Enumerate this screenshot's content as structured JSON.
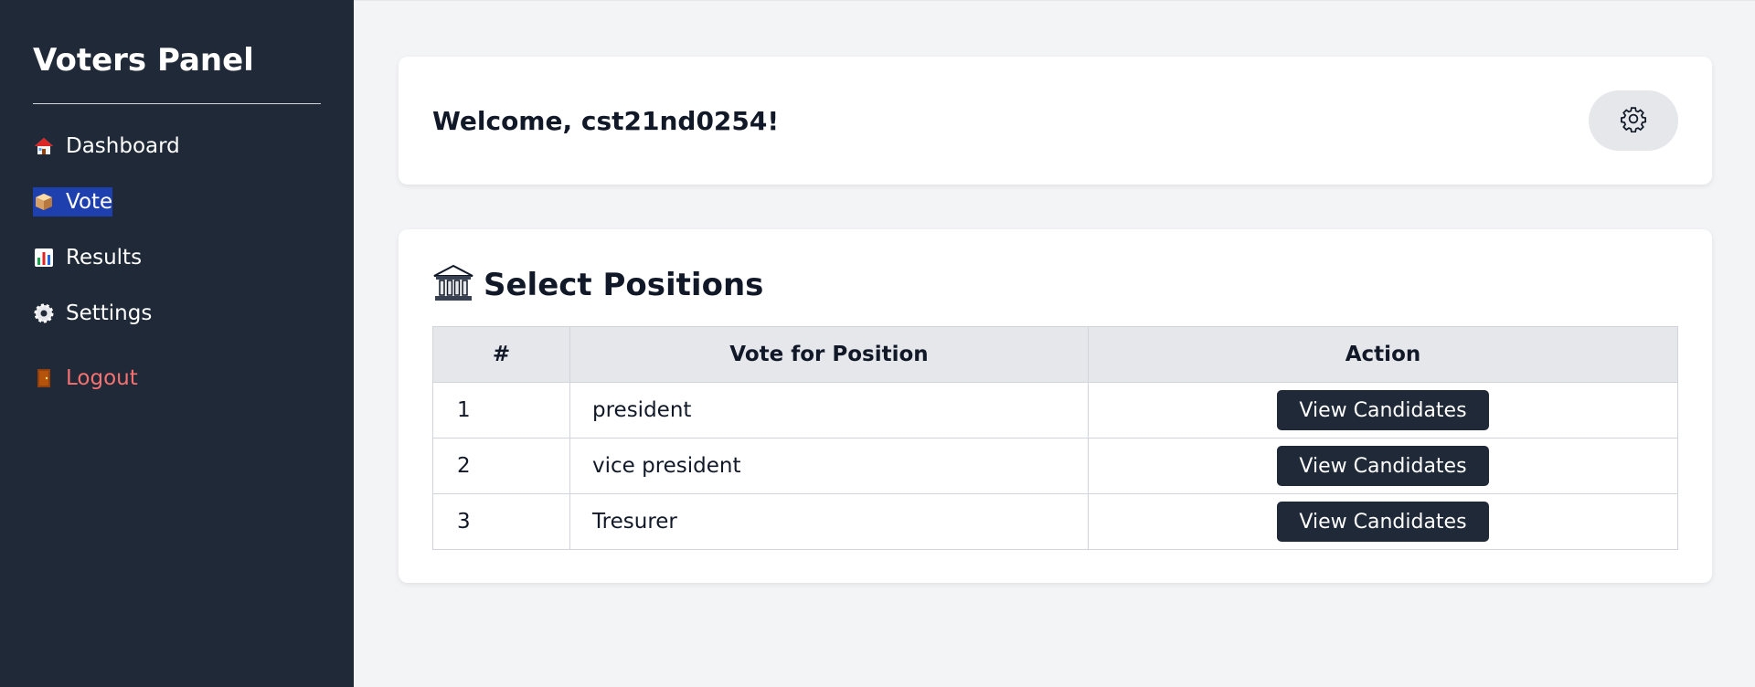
{
  "sidebar": {
    "title": "Voters Panel",
    "items": [
      {
        "label": "Dashboard",
        "icon": "house-icon"
      },
      {
        "label": "Vote",
        "icon": "ballot-box-icon",
        "active": true
      },
      {
        "label": "Results",
        "icon": "bar-chart-icon"
      },
      {
        "label": "Settings",
        "icon": "gear-icon"
      }
    ],
    "logout": {
      "label": "Logout",
      "icon": "door-icon"
    }
  },
  "welcome": {
    "prefix": "Welcome, ",
    "username": "cst21nd0254",
    "suffix": "!",
    "settings_icon": "gear-icon"
  },
  "positions": {
    "icon": "classical-building-icon",
    "title": "Select Positions",
    "columns": [
      "#",
      "Vote for Position",
      "Action"
    ],
    "rows": [
      {
        "num": "1",
        "position": "president",
        "action": "View Candidates"
      },
      {
        "num": "2",
        "position": "vice president",
        "action": "View Candidates"
      },
      {
        "num": "3",
        "position": "Tresurer",
        "action": "View Candidates"
      }
    ]
  },
  "colors": {
    "sidebar_bg": "#1f2937",
    "active_highlight": "#1e40af",
    "logout": "#f87171",
    "page_bg": "#f3f4f6",
    "button_bg": "#1f2937"
  }
}
